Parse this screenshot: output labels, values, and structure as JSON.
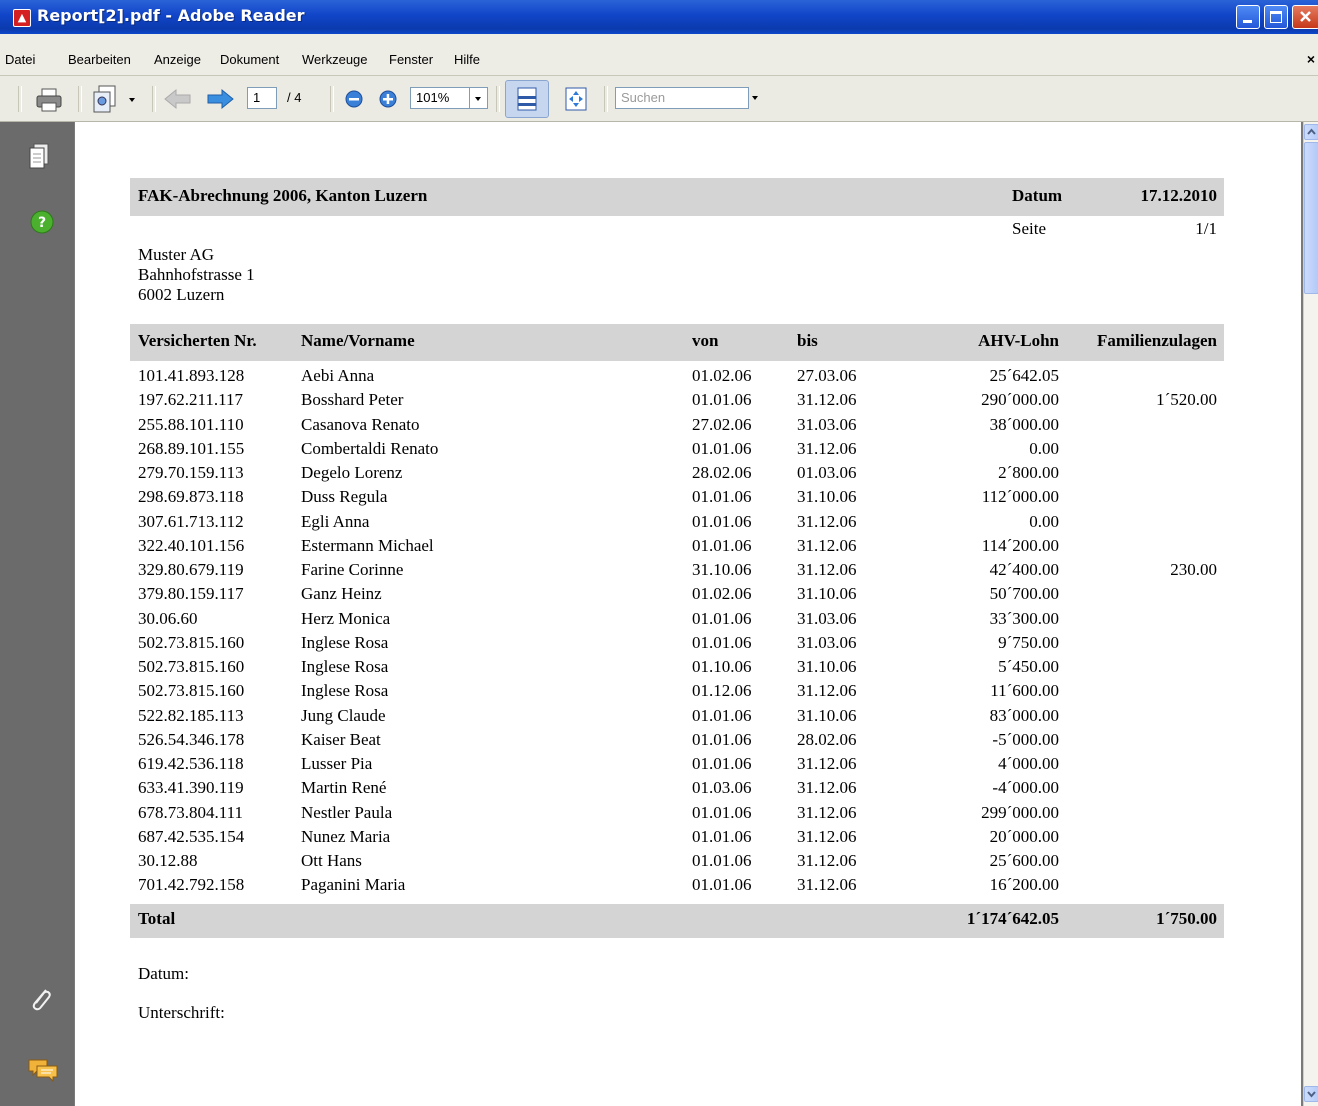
{
  "window": {
    "title": "Report[2].pdf - Adobe Reader"
  },
  "menu": [
    "Datei",
    "Bearbeiten",
    "Anzeige",
    "Dokument",
    "Werkzeuge",
    "Fenster",
    "Hilfe"
  ],
  "toolbar": {
    "page": "1",
    "page_total": "/ 4",
    "zoom": "101%",
    "search_placeholder": "Suchen"
  },
  "report": {
    "title": "FAK-Abrechnung 2006, Kanton Luzern",
    "datum_label": "Datum",
    "datum_value": "17.12.2010",
    "seite_label": "Seite",
    "seite_value": "1/1",
    "address": [
      "Muster AG",
      "Bahnhofstrasse 1",
      "6002 Luzern"
    ],
    "columns": [
      "Versicherten Nr.",
      "Name/Vorname",
      "von",
      "bis",
      "AHV-Lohn",
      "Familienzulagen"
    ],
    "rows": [
      [
        "101.41.893.128",
        "Aebi Anna",
        "01.02.06",
        "27.03.06",
        "25´642.05",
        ""
      ],
      [
        "197.62.211.117",
        "Bosshard Peter",
        "01.01.06",
        "31.12.06",
        "290´000.00",
        "1´520.00"
      ],
      [
        "255.88.101.110",
        "Casanova Renato",
        "27.02.06",
        "31.03.06",
        "38´000.00",
        ""
      ],
      [
        "268.89.101.155",
        "Combertaldi Renato",
        "01.01.06",
        "31.12.06",
        "0.00",
        ""
      ],
      [
        "279.70.159.113",
        "Degelo Lorenz",
        "28.02.06",
        "01.03.06",
        "2´800.00",
        ""
      ],
      [
        "298.69.873.118",
        "Duss Regula",
        "01.01.06",
        "31.10.06",
        "112´000.00",
        ""
      ],
      [
        "307.61.713.112",
        "Egli Anna",
        "01.01.06",
        "31.12.06",
        "0.00",
        ""
      ],
      [
        "322.40.101.156",
        "Estermann Michael",
        "01.01.06",
        "31.12.06",
        "114´200.00",
        ""
      ],
      [
        "329.80.679.119",
        "Farine Corinne",
        "31.10.06",
        "31.12.06",
        "42´400.00",
        "230.00"
      ],
      [
        "379.80.159.117",
        "Ganz Heinz",
        "01.02.06",
        "31.10.06",
        "50´700.00",
        ""
      ],
      [
        "30.06.60",
        "Herz Monica",
        "01.01.06",
        "31.03.06",
        "33´300.00",
        ""
      ],
      [
        "502.73.815.160",
        "Inglese Rosa",
        "01.01.06",
        "31.03.06",
        "9´750.00",
        ""
      ],
      [
        "502.73.815.160",
        "Inglese Rosa",
        "01.10.06",
        "31.10.06",
        "5´450.00",
        ""
      ],
      [
        "502.73.815.160",
        "Inglese Rosa",
        "01.12.06",
        "31.12.06",
        "11´600.00",
        ""
      ],
      [
        "522.82.185.113",
        "Jung Claude",
        "01.01.06",
        "31.10.06",
        "83´000.00",
        ""
      ],
      [
        "526.54.346.178",
        "Kaiser Beat",
        "01.01.06",
        "28.02.06",
        "-5´000.00",
        ""
      ],
      [
        "619.42.536.118",
        "Lusser Pia",
        "01.01.06",
        "31.12.06",
        "4´000.00",
        ""
      ],
      [
        "633.41.390.119",
        "Martin René",
        "01.03.06",
        "31.12.06",
        "-4´000.00",
        ""
      ],
      [
        "678.73.804.111",
        "Nestler Paula",
        "01.01.06",
        "31.12.06",
        "299´000.00",
        ""
      ],
      [
        "687.42.535.154",
        "Nunez Maria",
        "01.01.06",
        "31.12.06",
        "20´000.00",
        ""
      ],
      [
        "30.12.88",
        "Ott Hans",
        "01.01.06",
        "31.12.06",
        "25´600.00",
        ""
      ],
      [
        "701.42.792.158",
        "Paganini Maria",
        "01.01.06",
        "31.12.06",
        "16´200.00",
        ""
      ]
    ],
    "total_label": "Total",
    "total_ahv": "1´174´642.05",
    "total_fam": "1´750.00",
    "footer_datum": "Datum:",
    "footer_unterschrift": "Unterschrift:"
  }
}
